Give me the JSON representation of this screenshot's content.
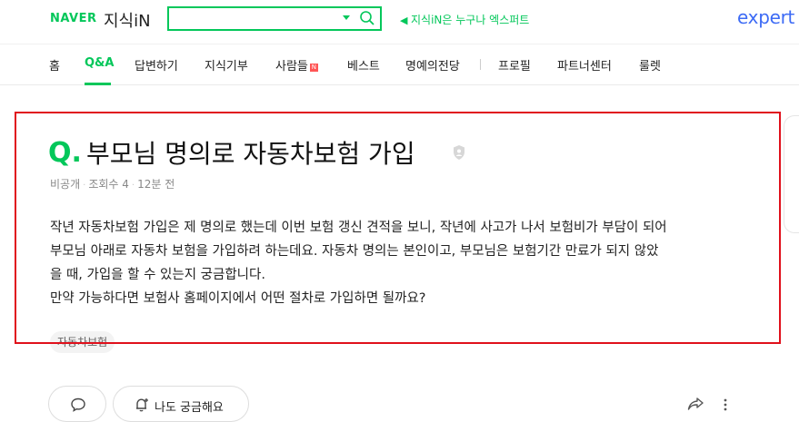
{
  "header": {
    "naver_logo": "NAVER",
    "service_name": "지식iN",
    "search": {
      "value": "",
      "placeholder": ""
    },
    "notice": "지식iN은 누구나 엑스퍼트",
    "expert_logo": "expert"
  },
  "nav": {
    "items": [
      {
        "label": "홈"
      },
      {
        "label": "Q&A",
        "active": true
      },
      {
        "label": "답변하기"
      },
      {
        "label": "지식기부"
      },
      {
        "label": "사람들",
        "badge": "N"
      },
      {
        "label": "베스트"
      },
      {
        "label": "명예의전당"
      },
      {
        "label": "프로필"
      },
      {
        "label": "파트너센터"
      },
      {
        "label": "룰렛"
      }
    ]
  },
  "question": {
    "q_mark": "Q.",
    "title": "부모님 명의로 자동차보험 가입",
    "author": "비공개",
    "views": "조회수 4",
    "time": "12분 전",
    "body_lines": [
      "작년 자동차보험 가입은 제 명의로 했는데 이번 보험 갱신 견적을 보니, 작년에 사고가 나서 보험비가 부담이 되어",
      "부모님 아래로 자동차 보험을 가입하려 하는데요. 자동차 명의는 본인이고, 부모님은 보험기간 만료가 되지 않았",
      "을 때, 가입을 할 수 있는지 궁금합니다.",
      "만약 가능하다면 보험사 홈페이지에서 어떤 절차로 가입하면 될까요?"
    ],
    "tag": "자동차보험"
  },
  "actions": {
    "curious_label": "나도 궁금해요"
  },
  "colors": {
    "accent": "#03c75a",
    "highlight": "#e0101b",
    "expert": "#3d6bf5"
  }
}
